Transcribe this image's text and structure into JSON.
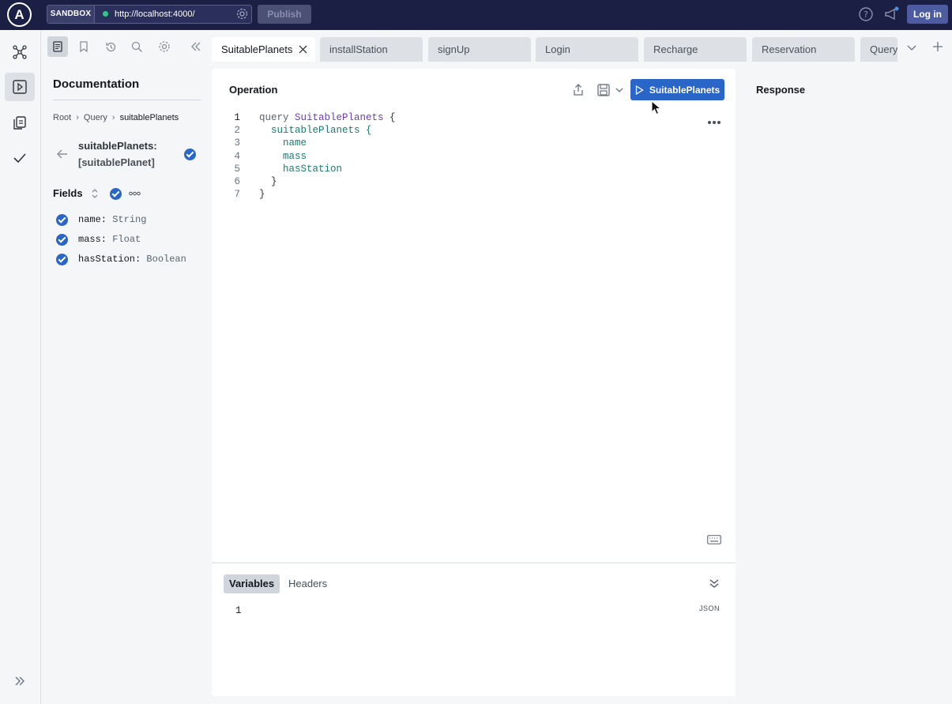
{
  "topbar": {
    "logo_letter": "A",
    "sandbox_label": "SANDBOX",
    "url": "http://localhost:4000/",
    "publish_label": "Publish",
    "login_label": "Log in"
  },
  "docs": {
    "title": "Documentation",
    "breadcrumb": [
      "Root",
      "Query",
      "suitablePlanets"
    ],
    "field_name": "suitablePlanets:",
    "field_type": "[suitablePlanet]",
    "fields_label": "Fields",
    "fields": [
      {
        "name": "name:",
        "type": "String"
      },
      {
        "name": "mass:",
        "type": "Float"
      },
      {
        "name": "hasStation:",
        "type": "Boolean"
      }
    ]
  },
  "tabs": [
    {
      "label": "SuitablePlanets"
    },
    {
      "label": "installStation"
    },
    {
      "label": "signUp"
    },
    {
      "label": "Login"
    },
    {
      "label": "Recharge"
    },
    {
      "label": "Reservation"
    },
    {
      "label": "Query"
    }
  ],
  "operation": {
    "title": "Operation",
    "run_label": "SuitablePlanets",
    "lines": [
      {
        "n": "1",
        "kw": "query ",
        "name": "SuitablePlanets",
        "rest": " {",
        "field": ""
      },
      {
        "n": "2",
        "kw": "",
        "name": "",
        "rest": "  suitablePlanets {",
        "field": ""
      },
      {
        "n": "3",
        "kw": "",
        "name": "",
        "rest": "",
        "field": "    name"
      },
      {
        "n": "4",
        "kw": "",
        "name": "",
        "rest": "",
        "field": "    mass"
      },
      {
        "n": "5",
        "kw": "",
        "name": "",
        "rest": "",
        "field": "    hasStation"
      },
      {
        "n": "6",
        "kw": "",
        "name": "",
        "rest": "  }",
        "field": ""
      },
      {
        "n": "7",
        "kw": "",
        "name": "",
        "rest": "}",
        "field": ""
      }
    ]
  },
  "variables": {
    "tab_variables": "Variables",
    "tab_headers": "Headers",
    "line_number": "1",
    "format_label": "JSON"
  },
  "response": {
    "title": "Response"
  },
  "colors": {
    "accent": "#2a66c8",
    "topbar": "#1b1f44"
  }
}
